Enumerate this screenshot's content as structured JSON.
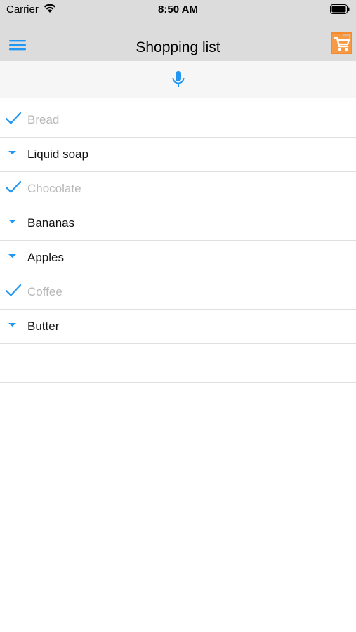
{
  "status_bar": {
    "carrier": "Carrier",
    "time": "8:50 AM"
  },
  "nav": {
    "title": "Shopping list",
    "menu_icon": "hamburger-menu-icon",
    "cart_icon": "shopping-cart-icon"
  },
  "voice": {
    "icon": "microphone-icon"
  },
  "colors": {
    "accent": "#2196F3",
    "cart_orange": "#F58A2E",
    "done_text": "#b8b8b8"
  },
  "items": [
    {
      "label": "Bread",
      "done": true
    },
    {
      "label": "Liquid soap",
      "done": false
    },
    {
      "label": "Chocolate",
      "done": true
    },
    {
      "label": "Bananas",
      "done": false
    },
    {
      "label": "Apples",
      "done": false
    },
    {
      "label": "Coffee",
      "done": true
    },
    {
      "label": "Butter",
      "done": false
    }
  ]
}
